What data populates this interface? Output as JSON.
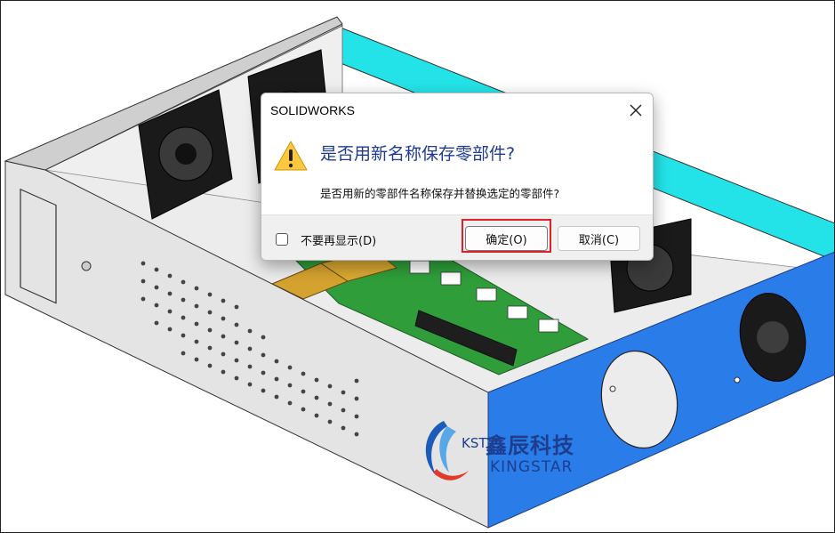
{
  "dialog": {
    "title": "SOLIDWORKS",
    "main_text": "是否用新名称保存零部件?",
    "sub_text": "是否用新的零部件名称保存并替换选定的零部件?",
    "checkbox_label": "不要再显示(D)",
    "checkbox_checked": false,
    "ok_label": "确定(O)",
    "cancel_label": "取消(C)",
    "icons": {
      "warning": "warning-icon",
      "close": "close-icon"
    }
  },
  "watermark": {
    "brand_cn": "鑫辰科技",
    "brand_abbr": "KST",
    "brand_en": "KINGSTAR"
  },
  "colors": {
    "accent_blue": "#2a7de8",
    "cyan_panel": "#22e0e6",
    "highlight_red": "#e0212d",
    "title_blue": "#1f3a93"
  }
}
